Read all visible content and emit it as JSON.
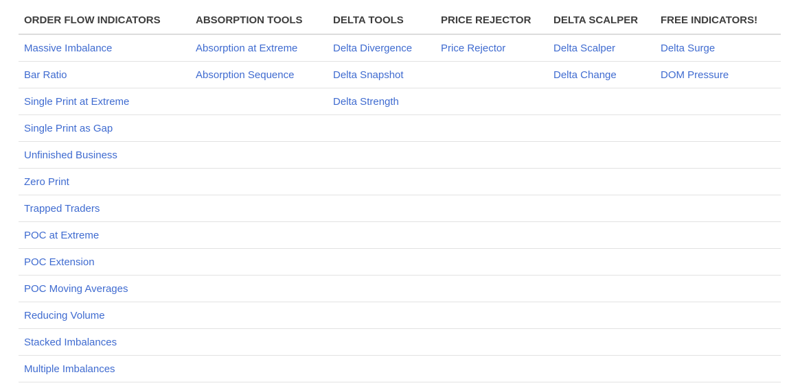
{
  "columns": [
    "ORDER FLOW INDICATORS",
    "ABSORPTION TOOLS",
    "DELTA TOOLS",
    "PRICE REJECTOR",
    "DELTA SCALPER",
    "FREE INDICATORS!"
  ],
  "rows": [
    [
      "Massive Imbalance",
      "Absorption at Extreme",
      "Delta Divergence",
      "Price Rejector",
      "Delta Scalper",
      "Delta Surge"
    ],
    [
      "Bar Ratio",
      "Absorption Sequence",
      "Delta Snapshot",
      "",
      "Delta Change",
      "DOM Pressure"
    ],
    [
      "Single Print at Extreme",
      "",
      "Delta Strength",
      "",
      "",
      ""
    ],
    [
      "Single Print as Gap",
      "",
      "",
      "",
      "",
      ""
    ],
    [
      "Unfinished Business",
      "",
      "",
      "",
      "",
      ""
    ],
    [
      "Zero Print",
      "",
      "",
      "",
      "",
      ""
    ],
    [
      "Trapped Traders",
      "",
      "",
      "",
      "",
      ""
    ],
    [
      "POC at Extreme",
      "",
      "",
      "",
      "",
      ""
    ],
    [
      "POC Extension",
      "",
      "",
      "",
      "",
      ""
    ],
    [
      "POC Moving Averages",
      "",
      "",
      "",
      "",
      ""
    ],
    [
      "Reducing Volume",
      "",
      "",
      "",
      "",
      ""
    ],
    [
      "Stacked Imbalances",
      "",
      "",
      "",
      "",
      ""
    ],
    [
      "Multiple Imbalances",
      "",
      "",
      "",
      "",
      ""
    ]
  ],
  "colors": {
    "header_text": "#3d3d3d",
    "link": "#3f6bd0",
    "divider": "#e2e2e2"
  }
}
